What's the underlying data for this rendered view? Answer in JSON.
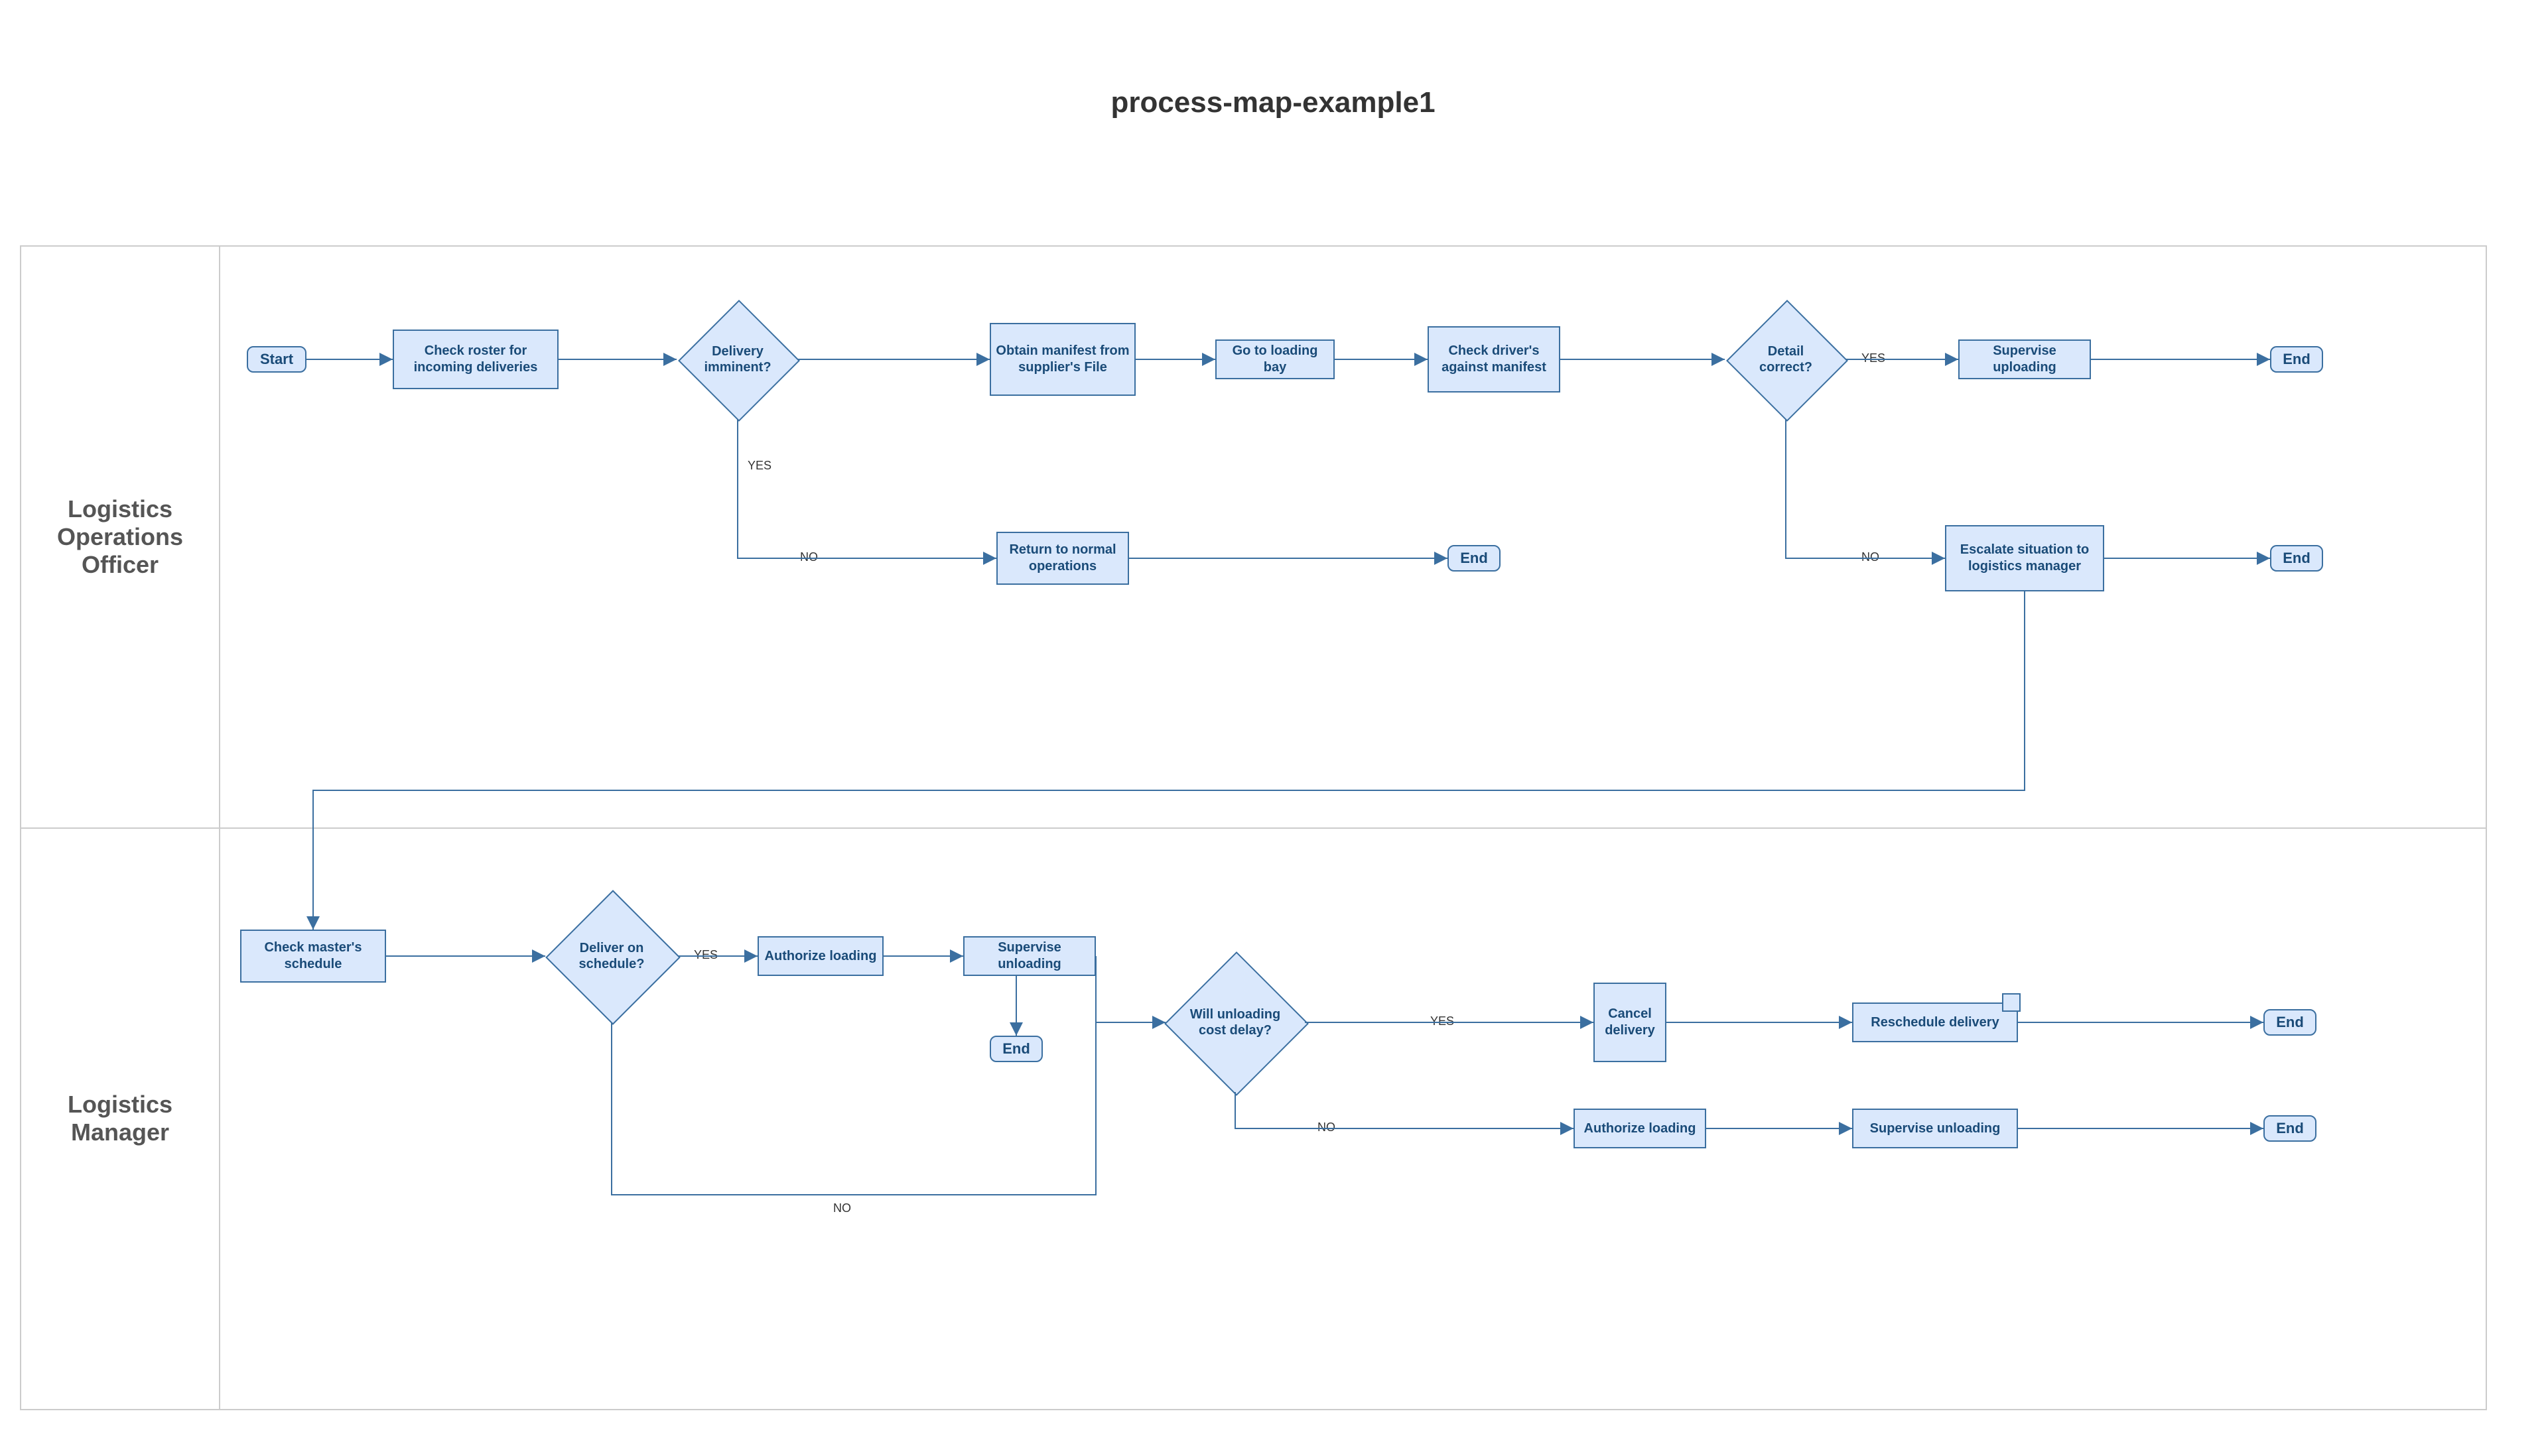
{
  "title": "process-map-example1",
  "lanes": {
    "officer": "Logistics Operations Officer",
    "manager": "Logistics Manager"
  },
  "nodes": {
    "start": "Start",
    "checkRoster": "Check roster for incoming deliveries",
    "deliveryImminent": "Delivery imminent?",
    "obtainManifest": "Obtain manifest from supplier's File",
    "goLoadingBay": "Go to loading bay",
    "checkDrivers": "Check driver's against manifest",
    "detailCorrect": "Detail correct?",
    "superviseUploading": "Supervise uploading",
    "end1": "End",
    "returnNormal": "Return to normal operations",
    "end2": "End",
    "escalate": "Escalate situation to logistics manager",
    "end3": "End",
    "checkMaster": "Check master's schedule",
    "deliverOnSchedule": "Deliver on schedule?",
    "authorizeLoading1": "Authorize loading",
    "superviseUnloading1": "Supervise unloading",
    "end4": "End",
    "willCostDelay": "Will unloading cost delay?",
    "cancelDelivery": "Cancel delivery",
    "rescheduleDelivery": "Reschedule delivery",
    "end5": "End",
    "authorizeLoading2": "Authorize loading",
    "superviseUnloading2": "Supervise unloading",
    "end6": "End"
  },
  "edgeLabels": {
    "yes": "YES",
    "no": "NO"
  }
}
